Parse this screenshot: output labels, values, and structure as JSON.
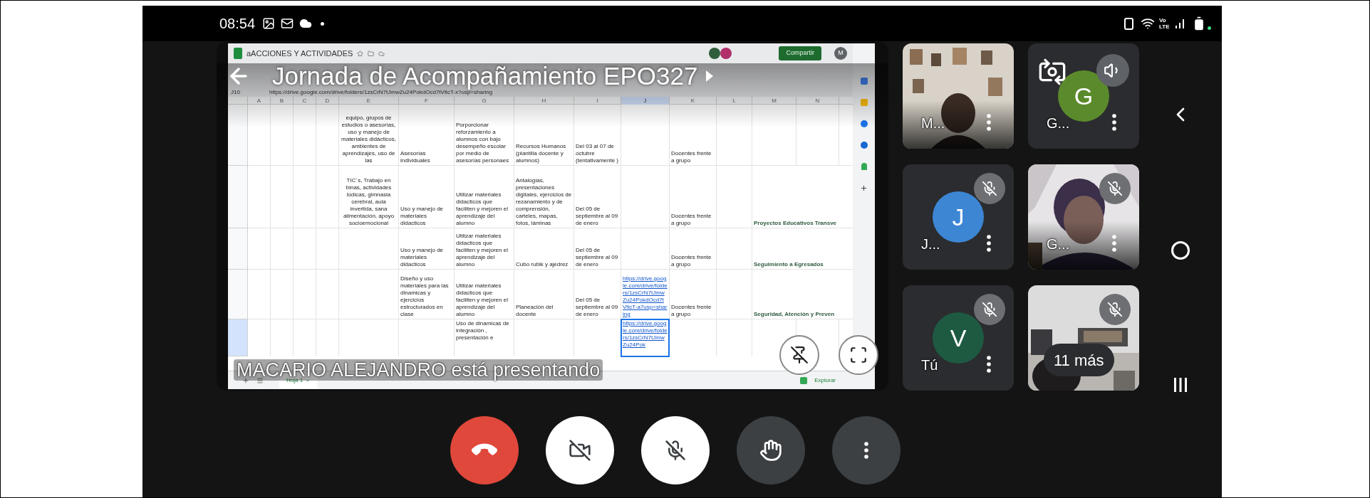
{
  "status_bar": {
    "time": "08:54",
    "network": "Vo LTE"
  },
  "presentation": {
    "title": "Jornada de Acompañamiento EPO327",
    "presenter_notice": "MACARIO ALEJANDRO está presentando"
  },
  "spreadsheet": {
    "title": "aACCIONES Y ACTIVIDADES",
    "cell_ref": "J10",
    "formula": "https://drive.google.com/drive/folders/1zsCrN7tJmwZu24PokdOcd7tVtlcT-x?usp=sharing",
    "share_button": "Compartir",
    "account_initial": "M",
    "columns": [
      {
        "label": "A",
        "kind": "text",
        "selected": false
      },
      {
        "label": "B",
        "kind": "text",
        "selected": false
      },
      {
        "label": "C",
        "kind": "text",
        "selected": false
      },
      {
        "label": "D",
        "kind": "text",
        "selected": false
      },
      {
        "label": "E",
        "kind": "centered",
        "selected": false
      },
      {
        "label": "F",
        "kind": "text",
        "selected": false
      },
      {
        "label": "G",
        "kind": "text",
        "selected": false
      },
      {
        "label": "H",
        "kind": "text",
        "selected": false
      },
      {
        "label": "I",
        "kind": "text",
        "selected": false
      },
      {
        "label": "J",
        "kind": "link",
        "selected": true
      },
      {
        "label": "K",
        "kind": "text",
        "selected": false
      },
      {
        "label": "L",
        "kind": "text",
        "selected": false
      },
      {
        "label": "M",
        "kind": "heading",
        "selected": false
      },
      {
        "label": "N",
        "kind": "text",
        "selected": false
      }
    ],
    "rows": [
      {
        "kind": "bottom",
        "selected": false,
        "cells": [
          "",
          "",
          "",
          "",
          "equipo, grupos de estudios o asesorías, uso y manejo de materiales didácticos, ambientes de aprendizajes, uso de las",
          "Asesorías individuales",
          "Porporcionar reforzamiento a alumnos con bajo desempeño escolar por medio de asesorías personaes",
          "Recursos Humanos (plantilla docente y alumnos)",
          "Del 03 al 07 de octubre (tentativamente )",
          "",
          "Docentes frente a grupo",
          "",
          "",
          ""
        ]
      },
      {
        "kind": "bottom",
        "selected": false,
        "cells": [
          "",
          "",
          "",
          "",
          "TIC´s, Trabajo en binas, actividades lúdicas, gimnasia cerebral, aula invertida, sana alimentación, apoyo socioemocional",
          "Uso y manejo de materiales didacticos",
          "Utilizar materiales didacticos que faciliten  y mejoren el aprendizaje del alumno",
          "Antalogías, presentaciones digitales, ejercicios de rezanamiento y de comprensión, carteles, mapas, fotos, láminas",
          "Del 05 de septiembre al 09 de enero",
          "",
          "Docentes frente a grupo",
          "",
          "Proyectos Educativos Transve",
          ""
        ]
      },
      {
        "kind": "bottom",
        "selected": false,
        "cells": [
          "",
          "",
          "",
          "",
          "",
          "Uso y manejo de materiales didacticos",
          "Utilizar materiales didacticos que faciliten  y mejoren el aprendizaje del alumno",
          "Cubo rubik y ajedrez",
          "Del 05 de septiembre al 09 de enero",
          "",
          "Docentes frente a grupo",
          "",
          "Seguimiento a Egresados",
          ""
        ]
      },
      {
        "kind": "bottom",
        "selected": false,
        "cells": [
          "",
          "",
          "",
          "",
          "",
          "Diseño y uso materiales para las dinamicas y ejercicios estructurados en clase",
          "Utilizar materiales didacticos que faciliten  y mejoren el aprendizaje del alumno",
          "Planeación del docente",
          "Del 05 de septiembre al 09 de enero",
          "https://drive.google.com/drive/folders/1zsCrN7tJmwZu24PokdOcd7tVtlcT-a7usp=sharing",
          "Docentes frente a grupo",
          "",
          "Seguridad, Atención y Preven",
          ""
        ]
      },
      {
        "kind": "top",
        "selected": true,
        "cells": [
          "",
          "",
          "",
          "",
          "",
          "",
          "Uso de dinamicas de integración , presentación e",
          "",
          "",
          "https://drive.google.com/drive/folders/1zsCrN7tJmwZu24Pok",
          "",
          "",
          "",
          ""
        ]
      }
    ],
    "sheet_tabs": [
      {
        "label": "Hoja 1",
        "selected": true
      }
    ],
    "explore": "Explorar"
  },
  "participants": [
    {
      "kind": "video",
      "name": "M...",
      "muted": false
    },
    {
      "kind": "avatar",
      "name": "G...",
      "initial": "G",
      "color": "#5b8a2c",
      "muted": false
    },
    {
      "kind": "avatar",
      "name": "J...",
      "initial": "J",
      "color": "#3d86d4",
      "muted": true
    },
    {
      "kind": "video",
      "name": "G...",
      "muted": true
    },
    {
      "kind": "avatar",
      "name": "Tú",
      "initial": "V",
      "color": "#1e5a42",
      "muted": true
    },
    {
      "kind": "video",
      "more": "11 más",
      "muted": true
    }
  ],
  "controls": [
    {
      "kind": "end_call"
    },
    {
      "kind": "camera",
      "on": false
    },
    {
      "kind": "mic",
      "on": false
    },
    {
      "kind": "raise_hand"
    },
    {
      "kind": "more"
    }
  ]
}
